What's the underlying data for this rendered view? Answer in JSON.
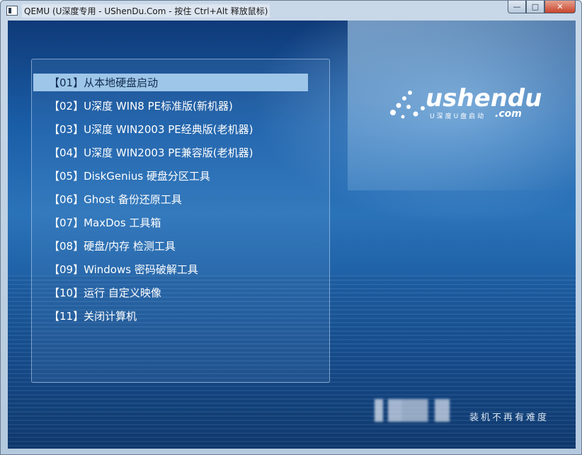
{
  "window": {
    "title": "QEMU (U深度专用 - UShenDu.Com - 按住 Ctrl+Alt 释放鼠标)",
    "buttons": {
      "minimize": "—",
      "maximize": "□",
      "close": "✕"
    }
  },
  "menu": {
    "selected_index": 0,
    "items": [
      "【01】从本地硬盘启动",
      "【02】U深度 WIN8 PE标准版(新机器)",
      "【03】U深度 WIN2003 PE经典版(老机器)",
      "【04】U深度 WIN2003 PE兼容版(老机器)",
      "【05】DiskGenius 硬盘分区工具",
      "【06】Ghost 备份还原工具",
      "【07】MaxDos 工具箱",
      "【08】硬盘/内存 检测工具",
      "【09】Windows 密码破解工具",
      "【10】运行 自定义映像",
      "【11】关闭计算机"
    ]
  },
  "logo": {
    "word": "ushendu",
    "sub": "U深度U盘启动",
    "domain": ".com"
  },
  "slogan": "装机不再有难度",
  "colors": {
    "selection": "#9ec6e8",
    "background": "#1a5ea8"
  }
}
